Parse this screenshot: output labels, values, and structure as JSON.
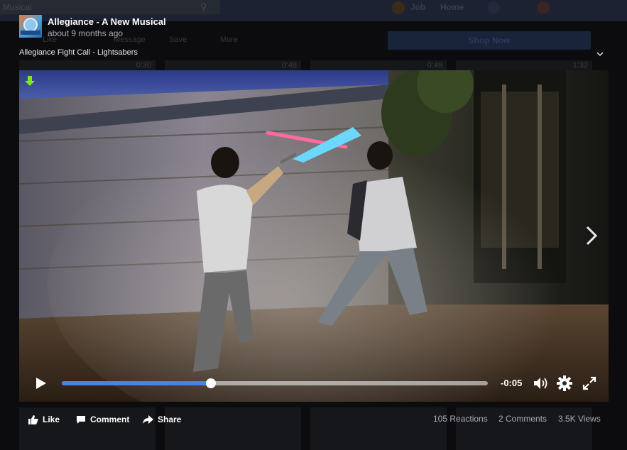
{
  "background": {
    "search_text": "Musical",
    "nav": [
      "Job",
      "Home"
    ],
    "shop_label": "Shop Now",
    "row_labels": [
      "Like",
      "Message",
      "Save",
      "More"
    ],
    "thumb_durations": [
      "0:30",
      "0:48",
      "0:49",
      "1:32"
    ]
  },
  "post": {
    "page_name": "Allegiance - A New Musical",
    "timestamp": "about 9 months ago",
    "video_title": "Allegiance Fight Call - Lightsabers"
  },
  "player": {
    "time_remaining": "-0:05",
    "progress_fraction": 0.35,
    "accent_color": "#4a80ec"
  },
  "actions": {
    "like": "Like",
    "comment": "Comment",
    "share": "Share"
  },
  "stats": {
    "reactions": "105 Reactions",
    "comments": "2 Comments",
    "views": "3.5K Views"
  },
  "icons": {
    "download": "download-icon",
    "next": "chevron-right-icon",
    "collapse": "chevron-down-icon",
    "play": "play-icon",
    "volume": "volume-icon",
    "settings": "gear-icon",
    "fullscreen": "fullscreen-icon"
  }
}
